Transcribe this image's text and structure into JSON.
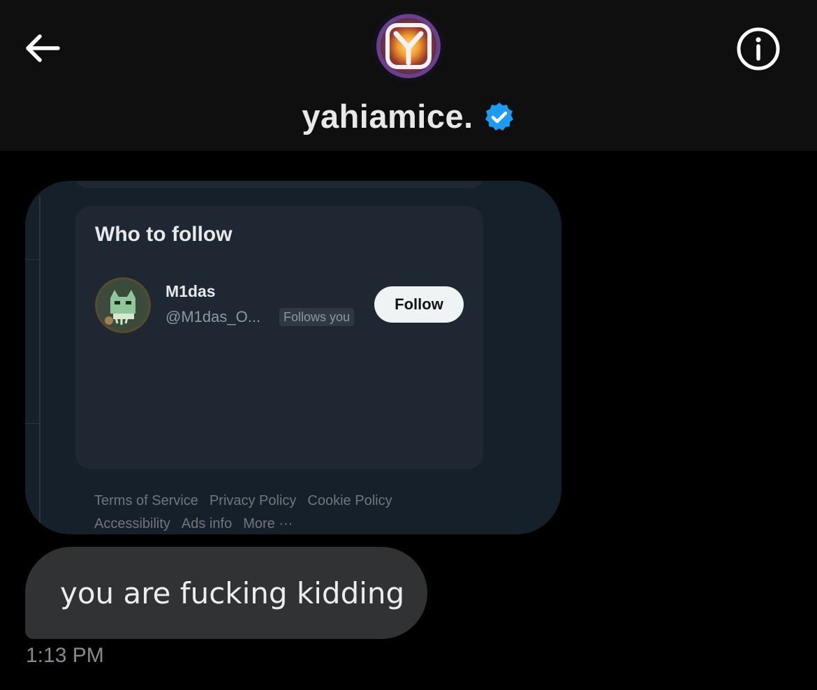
{
  "header": {
    "name": "yahiamice.",
    "verified": true,
    "avatar_icon": "yahiamice-avatar",
    "back_icon": "arrow-left-icon",
    "info_icon": "info-circle-icon"
  },
  "shared_screenshot": {
    "who_to_follow": {
      "title": "Who to follow",
      "suggestion": {
        "name": "M1das",
        "handle": "@M1das_O...",
        "badge": "Follows you",
        "follow_label": "Follow"
      }
    },
    "footer_links": [
      "Terms of Service",
      "Privacy Policy",
      "Cookie Policy",
      "Accessibility",
      "Ads info",
      "More ···"
    ]
  },
  "message": {
    "text": "you are fucking kidding",
    "time": "1:13 PM"
  },
  "colors": {
    "background": "#000000",
    "header_bg": "#0f0f10",
    "verified_blue": "#1d9bf0",
    "bubble_gray": "#303233",
    "card_bg": "#1e2732",
    "screenshot_bg": "#15202b"
  }
}
